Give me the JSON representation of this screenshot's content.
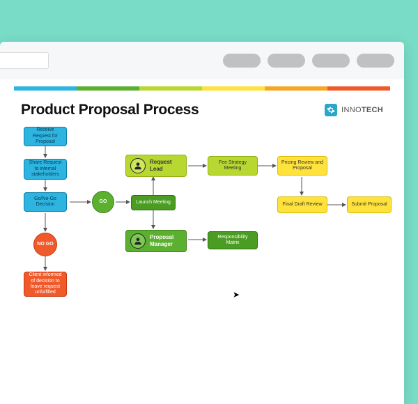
{
  "doc_title": "Product Proposal Process",
  "brand": {
    "thin": "INNO",
    "bold": "TECH"
  },
  "colors": {
    "strip": [
      "#2db4e0",
      "#5cb030",
      "#b9d731",
      "#ffe23b",
      "#f6a623",
      "#f05a2b"
    ]
  },
  "nodes": {
    "receive": "Receive Request for Proposal",
    "share": "Share Request to internal stakeholders",
    "decision": "Go/No-Go Decision",
    "go": "GO",
    "nogo": "NO GO",
    "inform": "Client informed of decision to leave request unfulfilled",
    "launch": "Launch Meeting",
    "role_lead": "Request Lead",
    "role_mgr": "Proposal Manager",
    "resp": "Responsibility Matrix",
    "fee": "Fee Strategy Meeting",
    "pricing": "Pricing Review and Proposal",
    "final": "Final Draft Review",
    "submit": "Submit Proposal"
  }
}
